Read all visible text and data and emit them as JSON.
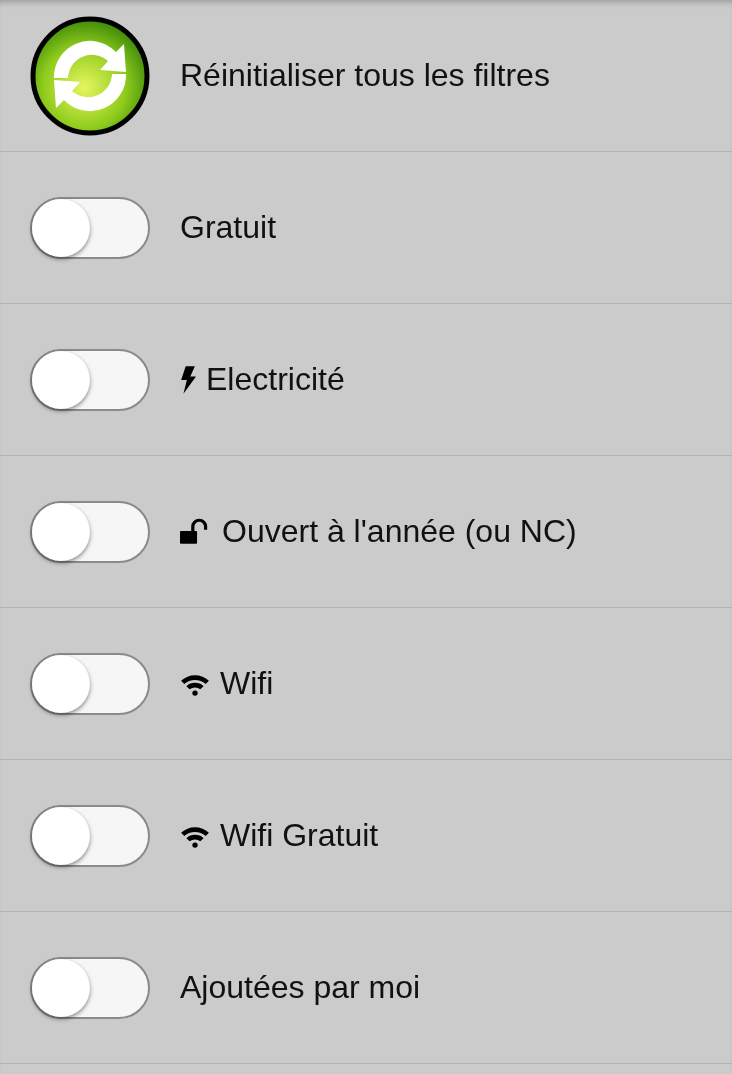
{
  "filters": [
    {
      "kind": "reset",
      "label": "Réinitialiser tous les filtres"
    },
    {
      "kind": "plain",
      "label": "Gratuit",
      "on": false
    },
    {
      "kind": "power",
      "label": "Electricité",
      "on": false
    },
    {
      "kind": "access",
      "label": "Ouvert à l'année (ou NC)",
      "on": false
    },
    {
      "kind": "wifi",
      "label": "Wifi",
      "on": false
    },
    {
      "kind": "wifi",
      "label": "Wifi Gratuit",
      "on": false
    },
    {
      "kind": "plain",
      "label": "Ajoutées par moi",
      "on": false
    }
  ]
}
